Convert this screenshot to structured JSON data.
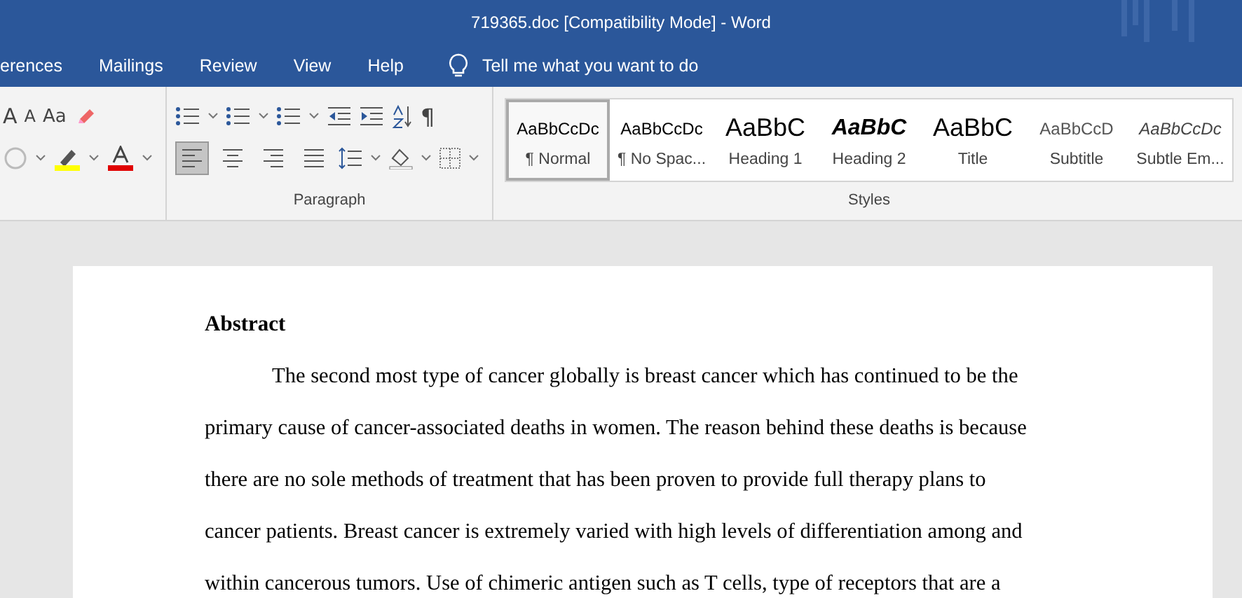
{
  "window": {
    "title": "719365.doc [Compatibility Mode]  -  Word"
  },
  "tabs": [
    {
      "label": "erences",
      "selected": false
    },
    {
      "label": "Mailings",
      "selected": false
    },
    {
      "label": "Review",
      "selected": false
    },
    {
      "label": "View",
      "selected": false
    },
    {
      "label": "Help",
      "selected": false
    }
  ],
  "tell_me": {
    "placeholder": "Tell me what you want to do"
  },
  "font_group": {
    "row1": [
      {
        "kind": "grow",
        "label": "A"
      },
      {
        "kind": "shrink",
        "label": "A"
      },
      {
        "kind": "case",
        "label": "Aa"
      },
      {
        "kind": "clear"
      }
    ],
    "row2": [
      {
        "kind": "effects"
      },
      {
        "kind": "highlight",
        "color": "#ffff00"
      },
      {
        "kind": "fontcolor",
        "color": "#e00000"
      }
    ]
  },
  "paragraph_group": {
    "label": "Paragraph",
    "row1": [
      {
        "kind": "bullets"
      },
      {
        "kind": "numbering"
      },
      {
        "kind": "multilevel"
      },
      {
        "kind": "outdent"
      },
      {
        "kind": "indent"
      },
      {
        "kind": "sort"
      },
      {
        "kind": "pilcrow",
        "label": "¶"
      }
    ],
    "alignment": [
      {
        "kind": "left",
        "selected": true
      },
      {
        "kind": "center",
        "selected": false
      },
      {
        "kind": "right",
        "selected": false
      },
      {
        "kind": "justify",
        "selected": false
      }
    ],
    "row2": [
      {
        "kind": "spacing"
      },
      {
        "kind": "shading"
      },
      {
        "kind": "borders"
      }
    ]
  },
  "styles_group": {
    "label": "Styles",
    "items": [
      {
        "sample": "AaBbCcDc",
        "label": "¶ Normal",
        "kind": "normal",
        "selected": true
      },
      {
        "sample": "AaBbCcDc",
        "label": "¶ No Spac...",
        "kind": "normal",
        "selected": false
      },
      {
        "sample": "AaBbC",
        "label": "Heading 1",
        "kind": "heading1",
        "selected": false
      },
      {
        "sample": "AaBbC",
        "label": "Heading 2",
        "kind": "heading2",
        "selected": false
      },
      {
        "sample": "AaBbC",
        "label": "Title",
        "kind": "title",
        "selected": false
      },
      {
        "sample": "AaBbCcD",
        "label": "Subtitle",
        "kind": "subtitle",
        "selected": false
      },
      {
        "sample": "AaBbCcDc",
        "label": "Subtle Em...",
        "kind": "emphasis",
        "selected": false
      }
    ]
  },
  "document": {
    "heading": "Abstract",
    "lines": [
      "The second most type of cancer globally is breast cancer which has continued to be the",
      "primary cause of cancer-associated deaths in women. The reason behind these deaths is because",
      "there are no sole methods of treatment that has been proven to provide full therapy plans to",
      "cancer patients. Breast cancer is extremely varied with high levels of differentiation among and",
      "within cancerous tumors. Use of chimeric antigen such as T cells, type of receptors that are a"
    ]
  }
}
